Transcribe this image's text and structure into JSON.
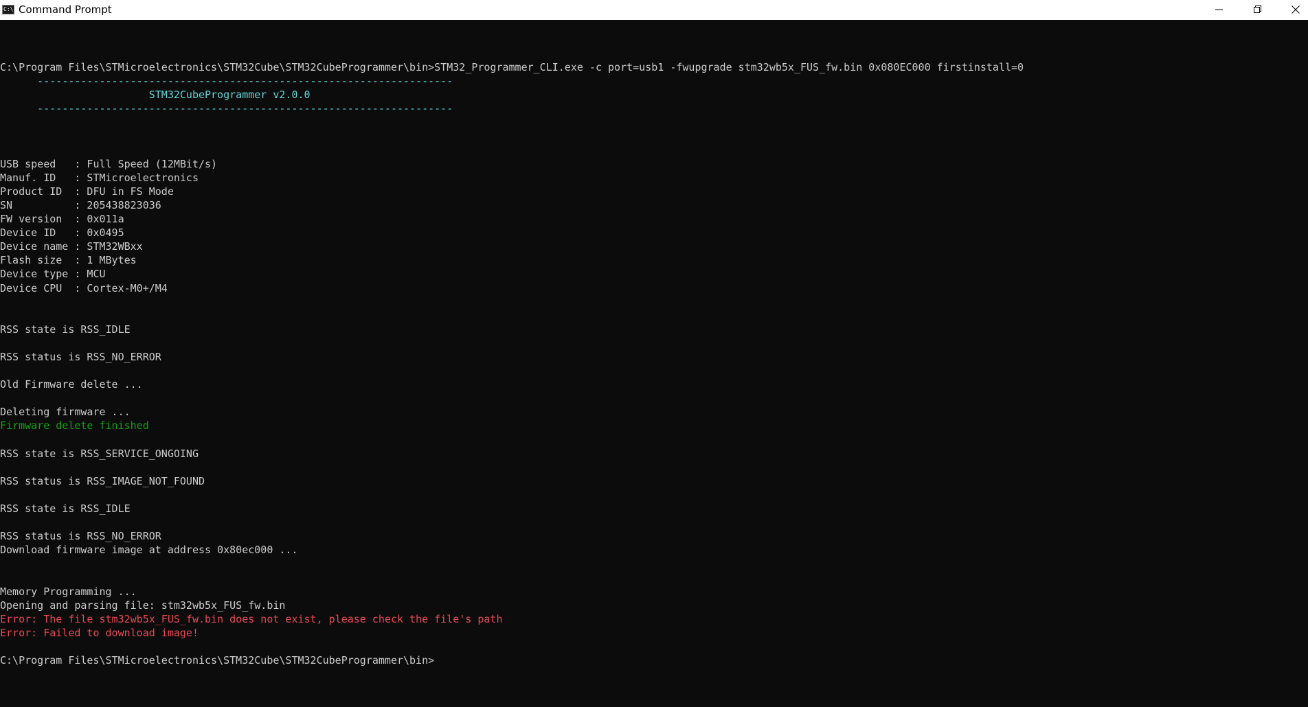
{
  "window": {
    "title": "Command Prompt",
    "icon_label": "C:\\",
    "icon": "cmd-icon"
  },
  "colors": {
    "background": "#0c0c0c",
    "text": "#cccccc",
    "cyan": "#61d6d6",
    "green": "#13a10e",
    "red": "#e74856"
  },
  "console": {
    "lines": [
      {
        "text": "C:\\Program Files\\STMicroelectronics\\STM32Cube\\STM32CubeProgrammer\\bin>STM32_Programmer_CLI.exe -c port=usb1 -fwupgrade stm32wb5x_FUS_fw.bin 0x080EC000 firstinstall=0",
        "color": "default"
      },
      {
        "text": "      -------------------------------------------------------------------",
        "color": "cyan"
      },
      {
        "text": "                        STM32CubeProgrammer v2.0.0",
        "color": "cyan"
      },
      {
        "text": "      -------------------------------------------------------------------",
        "color": "cyan"
      },
      {
        "text": "",
        "color": "default"
      },
      {
        "text": "",
        "color": "default"
      },
      {
        "text": "",
        "color": "default"
      },
      {
        "text": "USB speed   : Full Speed (12MBit/s)",
        "color": "default"
      },
      {
        "text": "Manuf. ID   : STMicroelectronics",
        "color": "default"
      },
      {
        "text": "Product ID  : DFU in FS Mode",
        "color": "default"
      },
      {
        "text": "SN          : 205438823036",
        "color": "default"
      },
      {
        "text": "FW version  : 0x011a",
        "color": "default"
      },
      {
        "text": "Device ID   : 0x0495",
        "color": "default"
      },
      {
        "text": "Device name : STM32WBxx",
        "color": "default"
      },
      {
        "text": "Flash size  : 1 MBytes",
        "color": "default"
      },
      {
        "text": "Device type : MCU",
        "color": "default"
      },
      {
        "text": "Device CPU  : Cortex-M0+/M4",
        "color": "default"
      },
      {
        "text": "",
        "color": "default"
      },
      {
        "text": "",
        "color": "default"
      },
      {
        "text": "RSS state is RSS_IDLE",
        "color": "default"
      },
      {
        "text": "",
        "color": "default"
      },
      {
        "text": "RSS status is RSS_NO_ERROR",
        "color": "default"
      },
      {
        "text": "",
        "color": "default"
      },
      {
        "text": "Old Firmware delete ...",
        "color": "default"
      },
      {
        "text": "",
        "color": "default"
      },
      {
        "text": "Deleting firmware ...",
        "color": "default"
      },
      {
        "text": "Firmware delete finished",
        "color": "green"
      },
      {
        "text": "",
        "color": "default"
      },
      {
        "text": "RSS state is RSS_SERVICE_ONGOING",
        "color": "default"
      },
      {
        "text": "",
        "color": "default"
      },
      {
        "text": "RSS status is RSS_IMAGE_NOT_FOUND",
        "color": "default"
      },
      {
        "text": "",
        "color": "default"
      },
      {
        "text": "RSS state is RSS_IDLE",
        "color": "default"
      },
      {
        "text": "",
        "color": "default"
      },
      {
        "text": "RSS status is RSS_NO_ERROR",
        "color": "default"
      },
      {
        "text": "Download firmware image at address 0x80ec000 ...",
        "color": "default"
      },
      {
        "text": "",
        "color": "default"
      },
      {
        "text": "",
        "color": "default"
      },
      {
        "text": "Memory Programming ...",
        "color": "default"
      },
      {
        "text": "Opening and parsing file: stm32wb5x_FUS_fw.bin",
        "color": "default"
      },
      {
        "text": "Error: The file stm32wb5x_FUS_fw.bin does not exist, please check the file's path",
        "color": "red"
      },
      {
        "text": "Error: Failed to download image!",
        "color": "red"
      },
      {
        "text": "",
        "color": "default"
      },
      {
        "text": "C:\\Program Files\\STMicroelectronics\\STM32Cube\\STM32CubeProgrammer\\bin>",
        "color": "default"
      }
    ]
  }
}
